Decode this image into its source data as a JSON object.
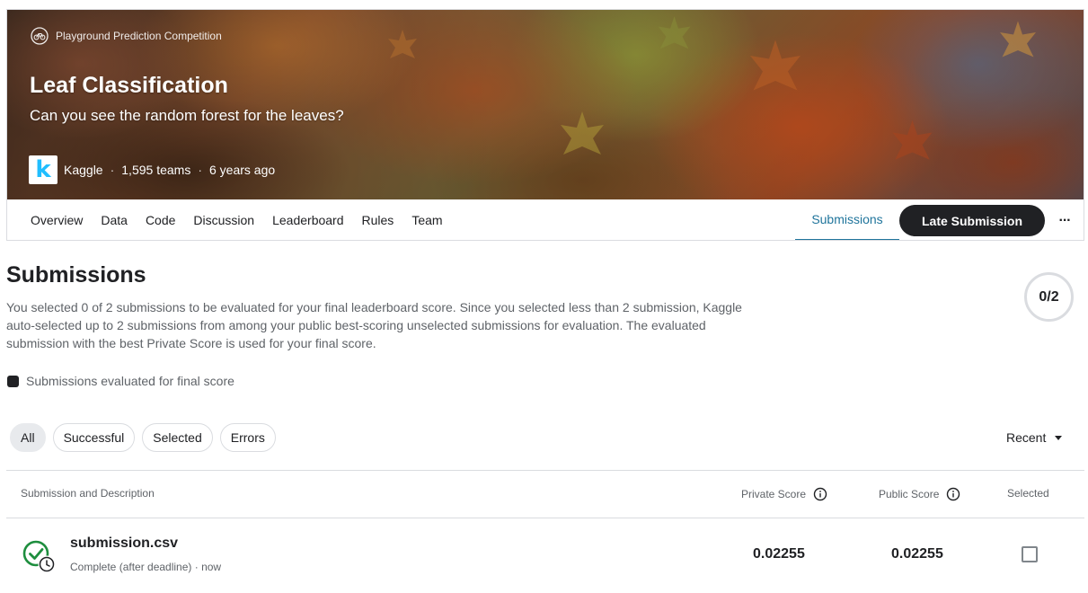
{
  "header": {
    "competition_type": "Playground Prediction Competition",
    "title": "Leaf Classification",
    "subtitle": "Can you see the random forest for the leaves?",
    "host_logo_letter": "k",
    "host": "Kaggle",
    "teams": "1,595 teams",
    "age": "6 years ago",
    "separator": "·"
  },
  "tabs": {
    "items": [
      {
        "label": "Overview"
      },
      {
        "label": "Data"
      },
      {
        "label": "Code"
      },
      {
        "label": "Discussion"
      },
      {
        "label": "Leaderboard"
      },
      {
        "label": "Rules"
      },
      {
        "label": "Team"
      }
    ],
    "active_label": "Submissions",
    "late_submission_label": "Late Submission",
    "more_label": "···"
  },
  "submissions": {
    "title": "Submissions",
    "description": "You selected 0 of 2 submissions to be evaluated for your final leaderboard score. Since you selected less than 2 submission, Kaggle auto-selected up to 2 submissions from among your public best-scoring unselected submissions for evaluation. The evaluated submission with the best Private Score is used for your final score.",
    "selected_count": "0/2",
    "legend_label": "Submissions evaluated for final score"
  },
  "filters": {
    "chips": [
      {
        "label": "All",
        "active": true
      },
      {
        "label": "Successful",
        "active": false
      },
      {
        "label": "Selected",
        "active": false
      },
      {
        "label": "Errors",
        "active": false
      }
    ],
    "sort_label": "Recent"
  },
  "table": {
    "columns": {
      "description": "Submission and Description",
      "private": "Private Score",
      "public": "Public Score",
      "selected": "Selected"
    },
    "rows": [
      {
        "file_name": "submission.csv",
        "status": "Complete (after deadline) · now",
        "private_score": "0.02255",
        "public_score": "0.02255",
        "selected": false
      }
    ]
  },
  "colors": {
    "accent": "#20759c",
    "dark_button": "#202124",
    "success_green": "#1e8e3e",
    "kaggle_blue": "#20beff"
  }
}
